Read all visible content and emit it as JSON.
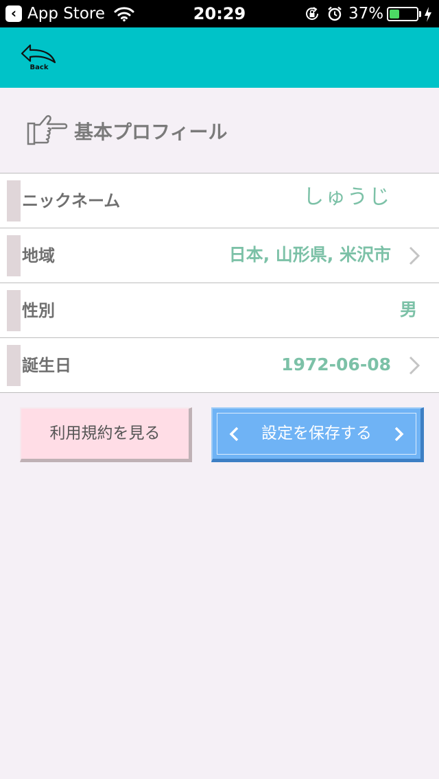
{
  "status_bar": {
    "back_app": "App Store",
    "time": "20:29",
    "battery_percent": "37%",
    "battery_level": 0.37
  },
  "header": {
    "back_label": "Back",
    "accent_color": "#00c3c8"
  },
  "section": {
    "title": "基本プロフィール"
  },
  "profile_rows": [
    {
      "label": "ニックネーム",
      "value": "しゅうじ"
    },
    {
      "label": "地域",
      "value": "日本, 山形県, 米沢市"
    },
    {
      "label": "性別",
      "value": "男"
    },
    {
      "label": "誕生日",
      "value": "1972-06-08"
    }
  ],
  "buttons": {
    "terms_label": "利用規約を見る",
    "save_label": "設定を保存する"
  },
  "colors": {
    "value_text": "#7cc1a7",
    "terms_button": "#ffdde6",
    "save_button": "#6fb3f5",
    "background": "#f5f0f6"
  }
}
